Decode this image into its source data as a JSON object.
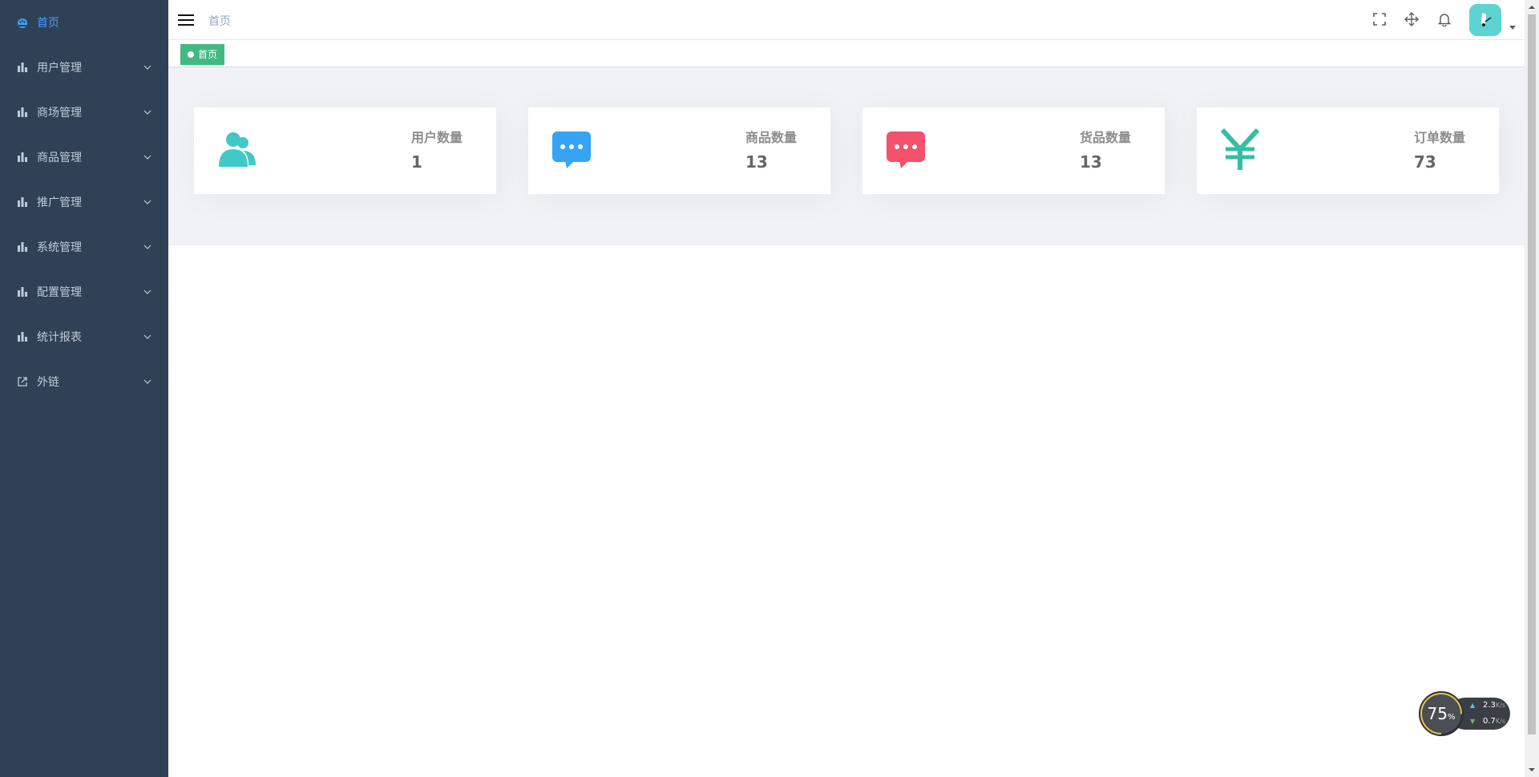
{
  "sidebar": {
    "items": [
      {
        "label": "首页",
        "icon": "dashboard-icon",
        "active": true
      },
      {
        "label": "用户管理",
        "icon": "chart-icon"
      },
      {
        "label": "商场管理",
        "icon": "chart-icon"
      },
      {
        "label": "商品管理",
        "icon": "chart-icon"
      },
      {
        "label": "推广管理",
        "icon": "chart-icon"
      },
      {
        "label": "系统管理",
        "icon": "chart-icon"
      },
      {
        "label": "配置管理",
        "icon": "chart-icon"
      },
      {
        "label": "统计报表",
        "icon": "chart-icon"
      },
      {
        "label": "外链",
        "icon": "external-link-icon"
      }
    ]
  },
  "navbar": {
    "breadcrumb": "首页"
  },
  "tags": {
    "active_tag": "首页"
  },
  "cards": [
    {
      "label": "用户数量",
      "value": "1",
      "icon": "users-icon",
      "color": "#40c9c6"
    },
    {
      "label": "商品数量",
      "value": "13",
      "icon": "message-icon",
      "color": "#36a3f7"
    },
    {
      "label": "货品数量",
      "value": "13",
      "icon": "message-icon",
      "color": "#f4516c"
    },
    {
      "label": "订单数量",
      "value": "73",
      "icon": "yen-icon",
      "color": "#34bfa3"
    }
  ],
  "net_widget": {
    "percent": "75",
    "percent_unit": "%",
    "upload": "2.3",
    "download": "0.7",
    "unit": "K/s"
  },
  "colors": {
    "sidebar_bg": "#304156",
    "sidebar_text": "#bfcbd9",
    "active": "#409EFF",
    "tag": "#42b983"
  }
}
